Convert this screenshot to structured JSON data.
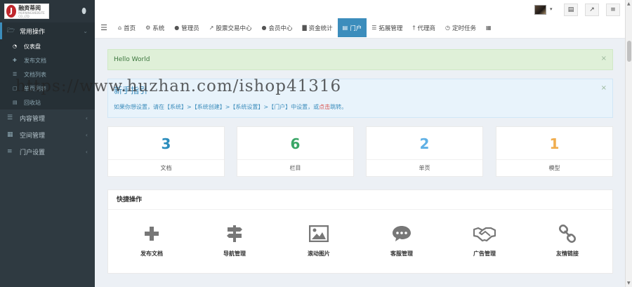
{
  "app": {
    "logo_text": "融资蒂阅",
    "logo_subtext": "MORNINGWEBSITE CO.,LTD"
  },
  "sidebar": {
    "groups": [
      {
        "label": "常用操作",
        "icon": "folder-open-icon",
        "expanded": true,
        "items": [
          {
            "label": "仪表盘",
            "icon": "dashboard-icon",
            "active": true
          },
          {
            "label": "发布文档",
            "icon": "plus-icon"
          },
          {
            "label": "文档列表",
            "icon": "list-icon"
          },
          {
            "label": "单页列表",
            "icon": "file-icon"
          },
          {
            "label": "回收站",
            "icon": "trash-icon"
          }
        ]
      },
      {
        "label": "内容管理",
        "icon": "list-icon"
      },
      {
        "label": "空间管理",
        "icon": "grid-icon"
      },
      {
        "label": "门户设置",
        "icon": "sliders-icon"
      }
    ]
  },
  "header": {
    "buttons": [
      {
        "icon": "trash-icon"
      },
      {
        "icon": "external-link-icon"
      },
      {
        "icon": "menu-icon"
      }
    ],
    "tabs": [
      {
        "label": "首页",
        "icon": "home-icon"
      },
      {
        "label": "系统",
        "icon": "gear-icon"
      },
      {
        "label": "管理员",
        "icon": "user-icon"
      },
      {
        "label": "股票交易中心",
        "icon": "chart-line-icon"
      },
      {
        "label": "会员中心",
        "icon": "users-icon"
      },
      {
        "label": "资金统计",
        "icon": "bar-chart-icon"
      },
      {
        "label": "门户",
        "icon": "list-alt-icon",
        "active": true
      },
      {
        "label": "拓展管理",
        "icon": "list-icon"
      },
      {
        "label": "代理商",
        "icon": "person-icon"
      },
      {
        "label": "定时任务",
        "icon": "clock-icon"
      },
      {
        "label": "",
        "icon": "grid-icon"
      }
    ]
  },
  "alerts": {
    "success_text": "Hello World",
    "info_title": "新手指引",
    "info_text_before": "如果你想设置，请在【系统】>【系统创建】>【系统设置】>【门户】中设置，或",
    "info_link": "点击",
    "info_text_after": "跳转。"
  },
  "watermark": "https://www.huzhan.com/ishop41316",
  "stats": [
    {
      "value": "3",
      "label": "文档",
      "color": "#2b8dbd"
    },
    {
      "value": "6",
      "label": "栏目",
      "color": "#3aa667"
    },
    {
      "value": "2",
      "label": "单页",
      "color": "#5fb0e5"
    },
    {
      "value": "1",
      "label": "模型",
      "color": "#f0ad4e"
    }
  ],
  "quick": {
    "title": "快捷操作",
    "items": [
      {
        "label": "发布文档",
        "icon": "plus-icon"
      },
      {
        "label": "导航管理",
        "icon": "signpost-icon"
      },
      {
        "label": "滚动图片",
        "icon": "image-icon"
      },
      {
        "label": "客服管理",
        "icon": "comment-icon"
      },
      {
        "label": "广告管理",
        "icon": "handshake-icon"
      },
      {
        "label": "友情链接",
        "icon": "link-icon"
      }
    ]
  }
}
